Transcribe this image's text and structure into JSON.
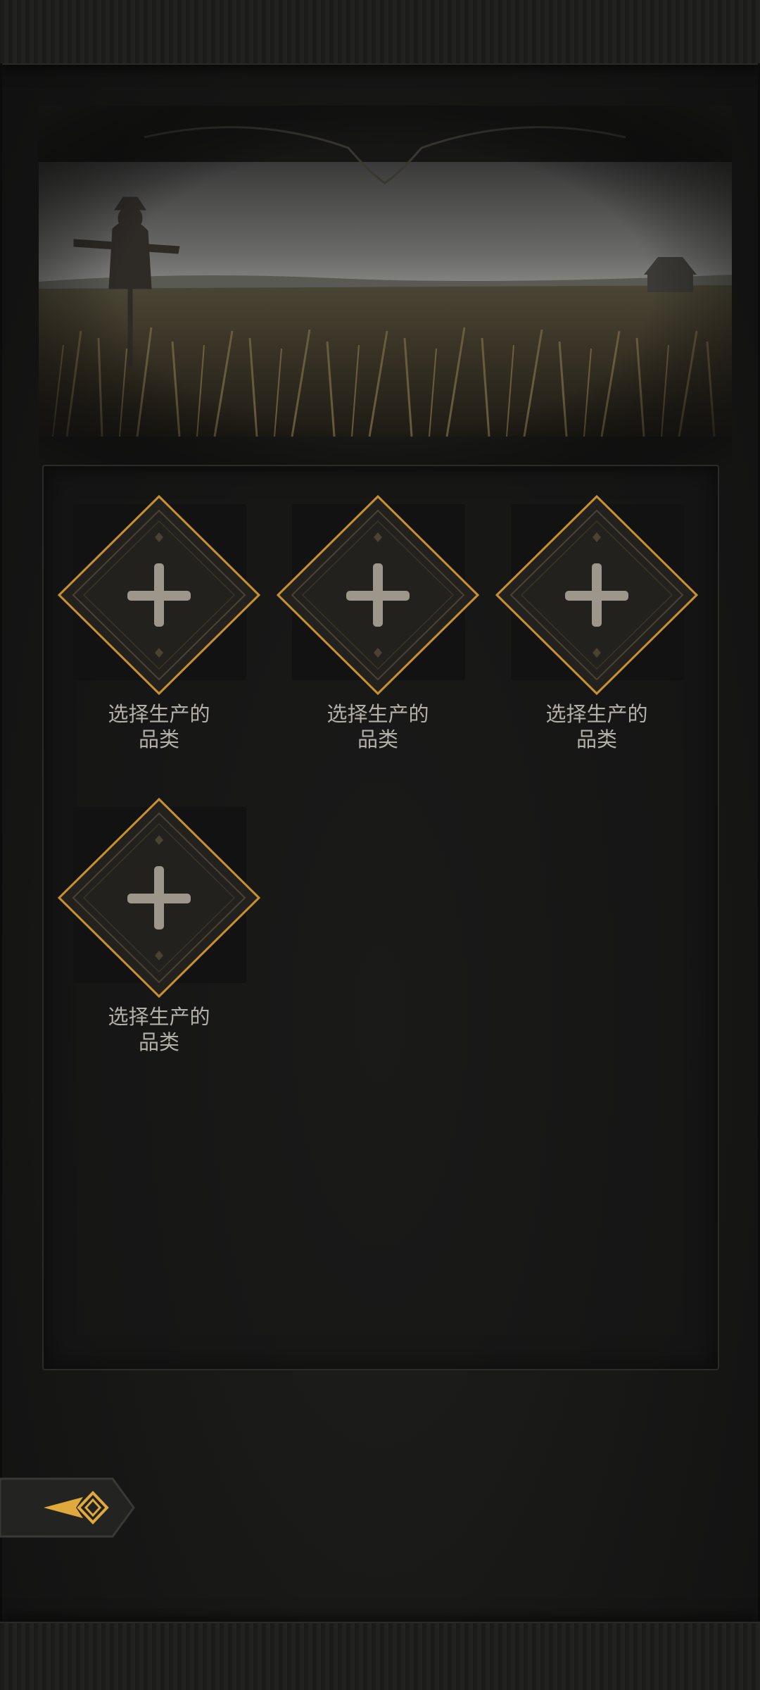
{
  "production": {
    "slots": [
      {
        "label_line1": "选择生产的",
        "label_line2": "品类"
      },
      {
        "label_line1": "选择生产的",
        "label_line2": "品类"
      },
      {
        "label_line1": "选择生产的",
        "label_line2": "品类"
      },
      {
        "label_line1": "选择生产的",
        "label_line2": "品类"
      }
    ]
  },
  "icons": {
    "slot_icon": "plus-icon",
    "back_icon": "arrow-left-icon"
  },
  "colors": {
    "accent_gold": "#c8912e",
    "label": "#b3b0aa",
    "background": "#171716"
  }
}
